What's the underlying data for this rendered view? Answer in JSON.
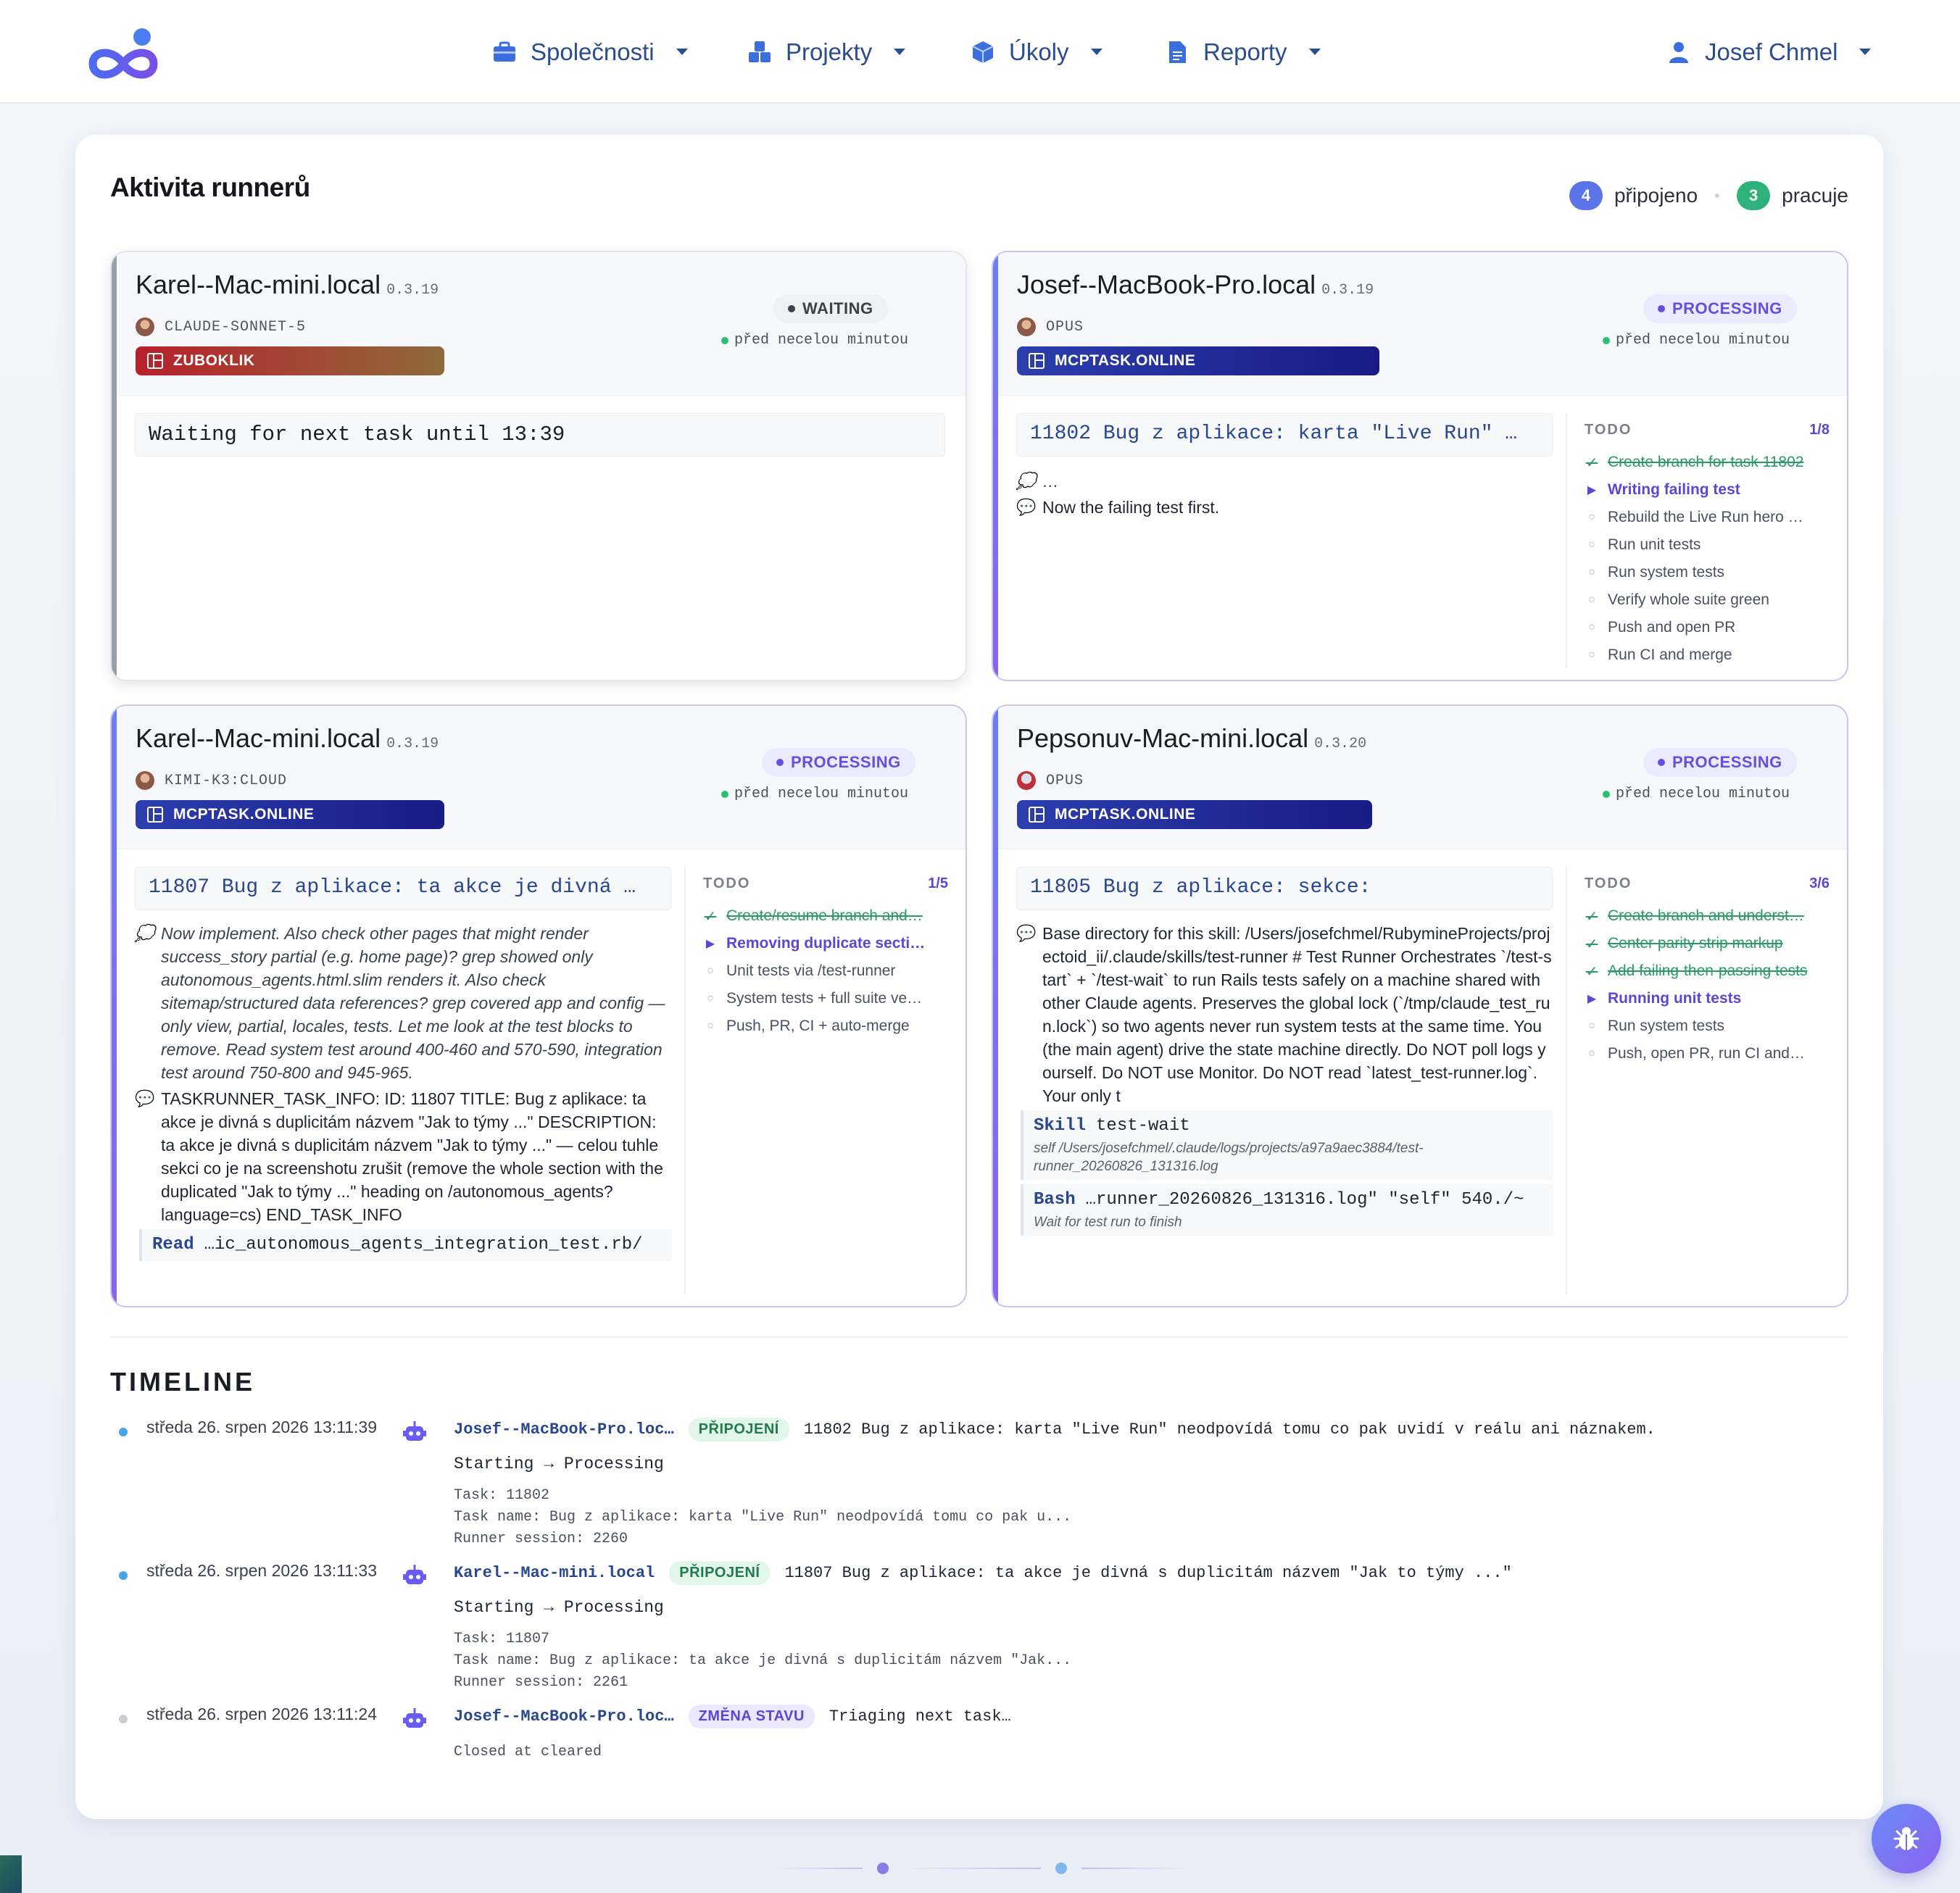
{
  "nav": {
    "items": [
      {
        "label": "Společnosti",
        "icon": "briefcase-icon"
      },
      {
        "label": "Projekty",
        "icon": "cubes-icon"
      },
      {
        "label": "Úkoly",
        "icon": "cube-icon"
      },
      {
        "label": "Reporty",
        "icon": "file-icon"
      }
    ],
    "user": {
      "label": "Josef Chmel",
      "icon": "user-icon"
    }
  },
  "colors": {
    "brand": "#3b5fe0",
    "processing": "#6650d9",
    "green": "#2ebd75",
    "connected_badge": "#5b74e8",
    "working_badge": "#2fb27a"
  },
  "activity": {
    "title": "Aktivita runnerů",
    "connected_count": "4",
    "connected_label": "připojeno",
    "working_count": "3",
    "working_label": "pracuje"
  },
  "runners": [
    {
      "name": "Karel--Mac-mini.local",
      "version": "0.3.19",
      "model": "CLAUDE-SONNET-5",
      "project": "ZUBOKLIK",
      "status": "WAITING",
      "since": "před necelou minutou",
      "waiting_text": "Waiting for next task until 13:39"
    },
    {
      "name": "Josef--MacBook-Pro.local",
      "version": "0.3.19",
      "model": "OPUS",
      "project": "MCPTASK.ONLINE",
      "status": "PROCESSING",
      "since": "před necelou minutou",
      "task": "11802 Bug z aplikace: karta \"Live Run\" …",
      "messages": [
        {
          "text": "…",
          "style": "thinking"
        },
        {
          "text": "Now the failing test first.",
          "style": "text"
        }
      ],
      "todo_label": "TODO",
      "todo_progress": "1/8",
      "todos": [
        {
          "text": "Create branch for task 11802",
          "state": "done"
        },
        {
          "text": "Writing failing test",
          "state": "current"
        },
        {
          "text": "Rebuild the Live Run hero …",
          "state": "pending"
        },
        {
          "text": "Run unit tests",
          "state": "pending"
        },
        {
          "text": "Run system tests",
          "state": "pending"
        },
        {
          "text": "Verify whole suite green",
          "state": "pending"
        },
        {
          "text": "Push and open PR",
          "state": "pending"
        },
        {
          "text": "Run CI and merge",
          "state": "pending"
        }
      ]
    },
    {
      "name": "Karel--Mac-mini.local",
      "version": "0.3.19",
      "model": "KIMI-K3:CLOUD",
      "project": "MCPTASK.ONLINE",
      "status": "PROCESSING",
      "since": "před necelou minutou",
      "task": "11807 Bug z aplikace: ta akce je divná …",
      "messages": [
        {
          "text": "Now implement. Also check other pages that might render success_story partial (e.g. home page)? grep showed only autonomous_agents.html.slim renders it. Also check sitemap/structured data references? grep covered app and config — only view, partial, locales, tests. Let me look at the test blocks to remove. Read system test around 400-460 and 570-590, integration test around 750-800 and 945-965.",
          "style": "thinking"
        },
        {
          "text": "TASKRUNNER_TASK_INFO: ID: 11807 TITLE: Bug z aplikace: ta akce je divná s duplicitám názvem \"Jak to týmy ...\" DESCRIPTION: ta akce je divná s duplicitám názvem \"Jak to týmy ...\" — celou tuhle sekci co je na screenshotu zrušit (remove the whole section with the duplicated \"Jak to týmy ...\" heading on /autonomous_agents?language=cs) END_TASK_INFO",
          "style": "text"
        }
      ],
      "tool": {
        "name": "Read",
        "arg": "…ic_autonomous_agents_integration_test.rb/"
      },
      "todo_label": "TODO",
      "todo_progress": "1/5",
      "todos": [
        {
          "text": "Create/resume branch and…",
          "state": "done"
        },
        {
          "text": "Removing duplicate secti…",
          "state": "current"
        },
        {
          "text": "Unit tests via /test-runner",
          "state": "pending"
        },
        {
          "text": "System tests + full suite ve…",
          "state": "pending"
        },
        {
          "text": "Push, PR, CI + auto-merge",
          "state": "pending"
        }
      ]
    },
    {
      "name": "Pepsonuv-Mac-mini.local",
      "version": "0.3.20",
      "model": "OPUS",
      "project": "MCPTASK.ONLINE",
      "status": "PROCESSING",
      "since": "před necelou minutou",
      "task": "11805 Bug z aplikace: sekce:",
      "messages": [
        {
          "text": "Base directory for this skill: /Users/josefchmel/RubymineProjects/projectoid_ii/.claude/skills/test-runner # Test Runner Orchestrates `/test-start` + `/test-wait` to run Rails tests safely on a machine shared with other Claude agents. Preserves the global lock (`/tmp/claude_test_run.lock`) so two agents never run system tests at the same time. You (the main agent) drive the state machine directly. Do NOT poll logs yourself. Do NOT use Monitor. Do NOT read `latest_test-runner.log`. Your only t",
          "style": "text"
        }
      ],
      "tools": [
        {
          "name": "Skill",
          "arg": "test-wait",
          "sub": "self /Users/josefchmel/.claude/logs/projects/a97a9aec3884/test-runner_20260826_131316.log"
        },
        {
          "name": "Bash",
          "arg": "…runner_20260826_131316.log\" \"self\" 540./~",
          "sub": "Wait for test run to finish"
        }
      ],
      "todo_label": "TODO",
      "todo_progress": "3/6",
      "todos": [
        {
          "text": "Create branch and underst…",
          "state": "done"
        },
        {
          "text": "Center parity strip markup",
          "state": "done"
        },
        {
          "text": "Add failing-then-passing tests",
          "state": "done"
        },
        {
          "text": "Running unit tests",
          "state": "current"
        },
        {
          "text": "Run system tests",
          "state": "pending"
        },
        {
          "text": "Push, open PR, run CI and…",
          "state": "pending"
        }
      ]
    }
  ],
  "timeline": {
    "title": "TIMELINE",
    "events": [
      {
        "time": "středa 26. srpen 2026 13:11:39",
        "runner": "Josef--MacBook-Pro.loc…",
        "tag": "PŘIPOJENÍ",
        "summary": "11802 Bug z aplikace: karta \"Live Run\" neodpovídá tomu co pak uvidí v reálu ani náznakem.",
        "transition": "Starting → Processing",
        "details": [
          "Task: 11802",
          "Task name: Bug z aplikace: karta \"Live Run\" neodpovídá tomu co pak u...",
          "Runner session: 2260"
        ]
      },
      {
        "time": "středa 26. srpen 2026 13:11:33",
        "runner": "Karel--Mac-mini.local",
        "tag": "PŘIPOJENÍ",
        "summary": "11807 Bug z aplikace: ta akce je divná s duplicitám názvem \"Jak to týmy ...\"",
        "transition": "Starting → Processing",
        "details": [
          "Task: 11807",
          "Task name: Bug z aplikace: ta akce je divná s duplicitám názvem \"Jak...",
          "Runner session: 2261"
        ]
      },
      {
        "time": "středa 26. srpen 2026 13:11:24",
        "runner": "Josef--MacBook-Pro.loc…",
        "tag": "ZMĚNA STAVU",
        "summary": "Triaging next task…",
        "transition": "Closed at cleared",
        "details": []
      }
    ]
  }
}
